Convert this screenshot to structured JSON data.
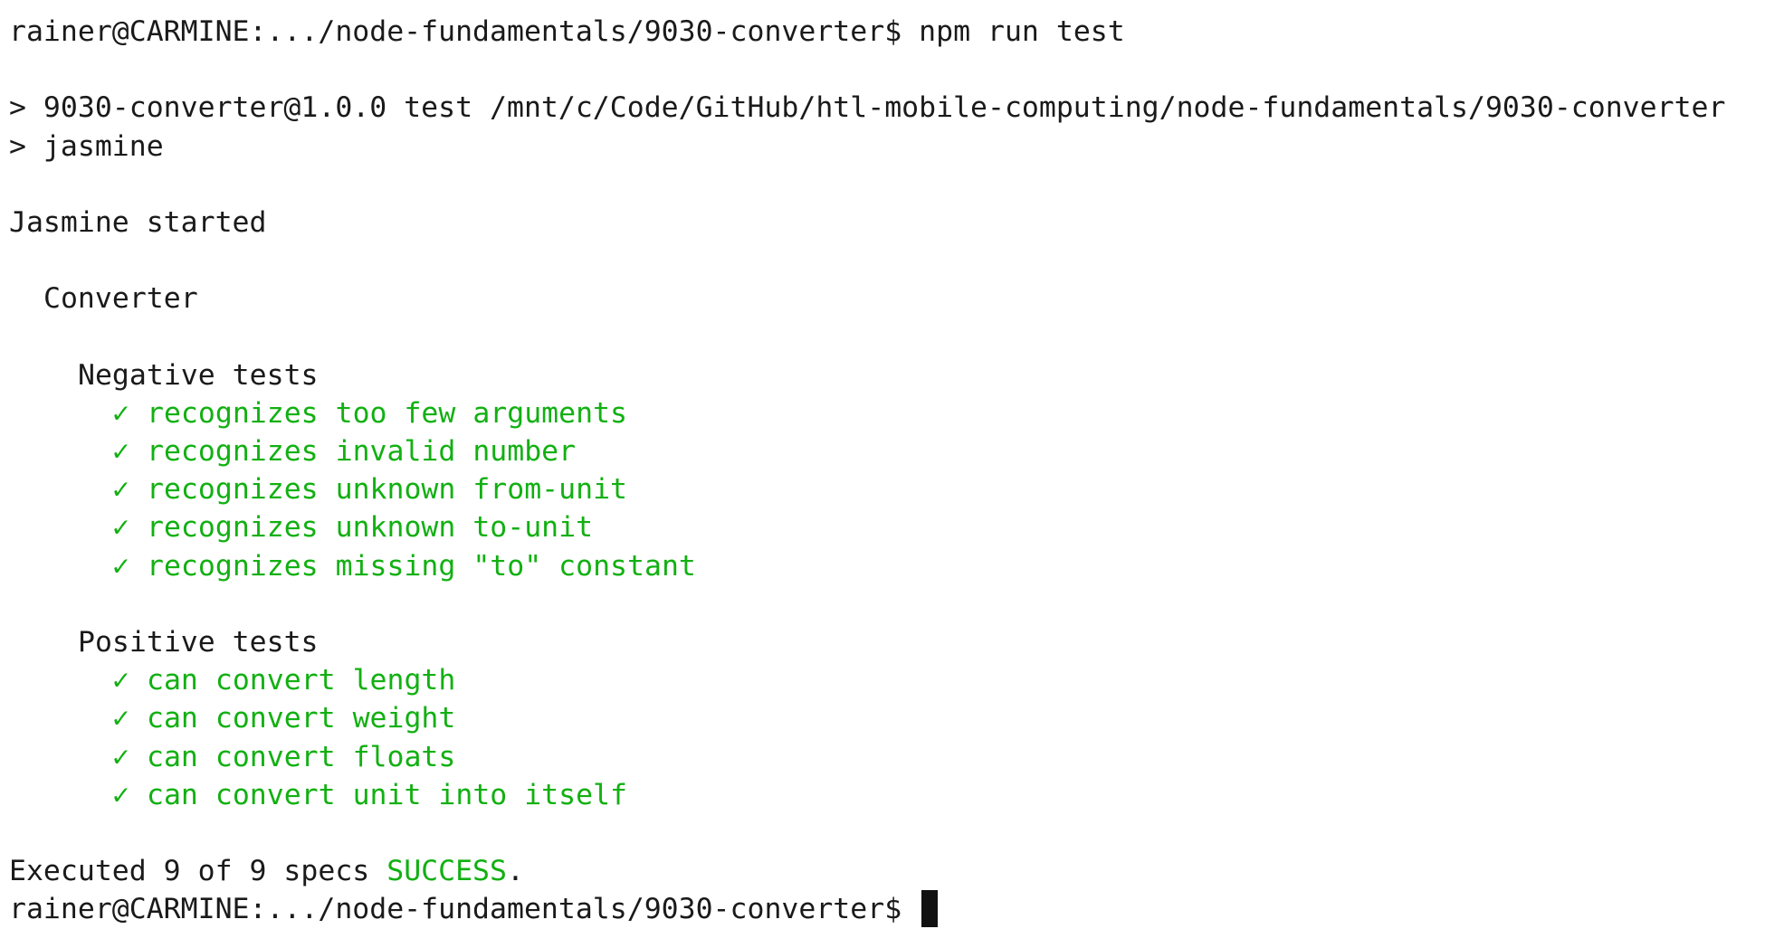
{
  "terminal": {
    "prompt": "rainer@CARMINE:.../node-fundamentals/9030-converter$",
    "command": "npm run test",
    "npm_script_line": "> 9030-converter@1.0.0 test /mnt/c/Code/GitHub/htl-mobile-computing/node-fundamentals/9030-converter",
    "npm_command_line": "> jasmine",
    "jasmine_started": "Jasmine started",
    "suite": "Converter",
    "check_mark": "✓",
    "negative_group": "Negative tests",
    "negative_specs": [
      "recognizes too few arguments",
      "recognizes invalid number",
      "recognizes unknown from-unit",
      "recognizes unknown to-unit",
      "recognizes missing \"to\" constant"
    ],
    "positive_group": "Positive tests",
    "positive_specs": [
      "can convert length",
      "can convert weight",
      "can convert floats",
      "can convert unit into itself"
    ],
    "summary_prefix": "Executed 9 of 9 specs",
    "summary_status": "SUCCESS",
    "summary_suffix": ".",
    "final_prompt": "rainer@CARMINE:.../node-fundamentals/9030-converter$"
  },
  "colors": {
    "background": "#ffffff",
    "text": "#1a1a1a",
    "success": "#12b012",
    "cursor": "#111111"
  }
}
